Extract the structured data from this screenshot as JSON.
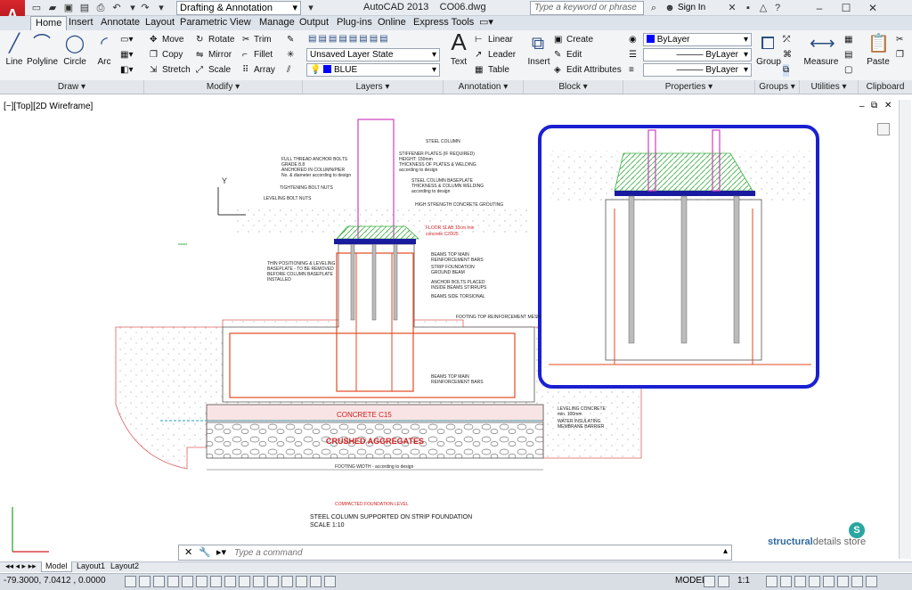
{
  "app": {
    "title": "AutoCAD 2013",
    "file": "CO06.dwg",
    "workspace": "Drafting & Annotation",
    "search_placeholder": "Type a keyword or phrase",
    "signin": "Sign In"
  },
  "tabs": [
    "Home",
    "Insert",
    "Annotate",
    "Layout",
    "Parametric",
    "View",
    "Manage",
    "Output",
    "Plug-ins",
    "Online",
    "Express Tools"
  ],
  "panels": {
    "draw": {
      "label": "Draw",
      "tools": [
        "Line",
        "Polyline",
        "Circle",
        "Arc"
      ]
    },
    "modify": {
      "label": "Modify",
      "tools": [
        "Move",
        "Rotate",
        "Trim",
        "Copy",
        "Mirror",
        "Fillet",
        "Stretch",
        "Scale",
        "Array"
      ]
    },
    "layers": {
      "label": "Layers",
      "state": "Unsaved Layer State",
      "current": "BLUE"
    },
    "annotation": {
      "label": "Annotation",
      "text": "Text",
      "linear": "Linear",
      "leader": "Leader",
      "table": "Table"
    },
    "block": {
      "label": "Block",
      "insert": "Insert",
      "create": "Create",
      "edit": "Edit",
      "edit_attributes": "Edit Attributes"
    },
    "properties": {
      "label": "Properties",
      "color": "ByLayer",
      "linetype": "ByLayer",
      "lineweight": "ByLayer"
    },
    "groups": {
      "label": "Groups",
      "group": "Group"
    },
    "utilities": {
      "label": "Utilities",
      "measure": "Measure"
    },
    "clipboard": {
      "label": "Clipboard",
      "paste": "Paste"
    }
  },
  "viewport": {
    "label": "[−][Top][2D Wireframe]"
  },
  "drawing": {
    "labels": {
      "steel_column": "STEEL COLUMN",
      "anchor_bolts": "FULL THREAD ANCHOR BOLTS",
      "anchor_grade": "GRADE 8.8",
      "anchor_note": "ANCHORED IN COLUMN/PIER",
      "anchor_dia": "No. & diameter according to design",
      "stiffener": "STIFFENER PLATES (IF REQUIRED)",
      "stiffener_h": "HEIGHT: 150mm",
      "stiffener_t": "THICKNESS OF PLATES & WELDING",
      "stiffener_d": "according to design",
      "baseplate": "STEEL COLUMN BASEPLATE",
      "baseplate_t": "THICKNESS & COLUMN WELDING",
      "baseplate_d": "according to design",
      "tightening": "TIGHTENING BOLT NUTS",
      "leveling": "LEVELING BOLT NUTS",
      "grouting": "HIGH STRENGTH CONCRETE GROUTING",
      "floor_slab": "FLOOR SLAB 10cm min",
      "floor_concrete": "concrete C20/25",
      "beams_top": "BEAMS TOP MAIN",
      "reinf_bars": "REINFORCEMENT BARS",
      "strip_foundation": "STRIP FOUNDATION",
      "ground_beam": "GROUND BEAM",
      "anchor_placed": "ANCHOR BOLTS PLACED",
      "inside_beam": "INSIDE BEAMS STIRRUPS",
      "beams_side": "BEAMS SIDE TORSIONAL",
      "positioning": "THIN POSITIONING & LEVELING",
      "positioning2": "BASEPLATE - TO BE REMOVED",
      "positioning3": "BEFORE COLUMN BASEPLATE",
      "positioning4": "INSTALLED",
      "footing_top": "FOOTING TOP REINFORCEMENT MESH",
      "beams_top2": "BEAMS TOP MAIN",
      "reinf_bars2": "REINFORCEMENT BARS",
      "concrete_c15": "CONCRETE C15",
      "crushed": "CRUSHED AGGREGATES",
      "leveling_concrete": "LEVELING CONCRETE",
      "leveling_min": "min. 100mm",
      "water": "WATER INSULATING",
      "membrane": "MEMBRANE BARRIER",
      "footing_width": "FOOTING WIDTH - according to design",
      "compacted": "COMPACTED FOUNDATION LEVEL",
      "caption": "STEEL COLUMN SUPPORTED ON STRIP FOUNDATION",
      "scale": "SCALE 1:10"
    }
  },
  "brand": {
    "name_bold": "structural",
    "name_rest": "details store",
    "logo": "S"
  },
  "command": {
    "placeholder": "Type a command"
  },
  "layout_tabs": [
    "Model",
    "Layout1",
    "Layout2"
  ],
  "status": {
    "coords": "-79.3000, 7.0412 , 0.0000",
    "model": "MODEL",
    "scale": "1:1"
  }
}
